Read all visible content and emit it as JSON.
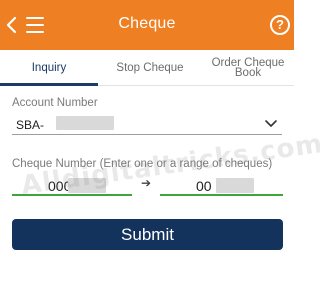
{
  "header": {
    "title": "Cheque",
    "help_glyph": "?",
    "color": "#ee7f22"
  },
  "tabs": [
    {
      "label": "Inquiry",
      "active": true
    },
    {
      "label": "Stop Cheque",
      "active": false
    },
    {
      "label": "Order Cheque Book",
      "active": false
    }
  ],
  "account": {
    "label": "Account Number",
    "value_prefix": "SBA-"
  },
  "cheque": {
    "label": "Cheque Number (Enter one or a range of cheques)",
    "from_prefix": "000",
    "to_prefix": "00",
    "arrow": "➔"
  },
  "submit_label": "Submit",
  "watermark": "Alldigitaltricks.com",
  "colors": {
    "primary": "#13335c",
    "accent": "#ee7f22",
    "valid_underline": "#3ea53a"
  }
}
